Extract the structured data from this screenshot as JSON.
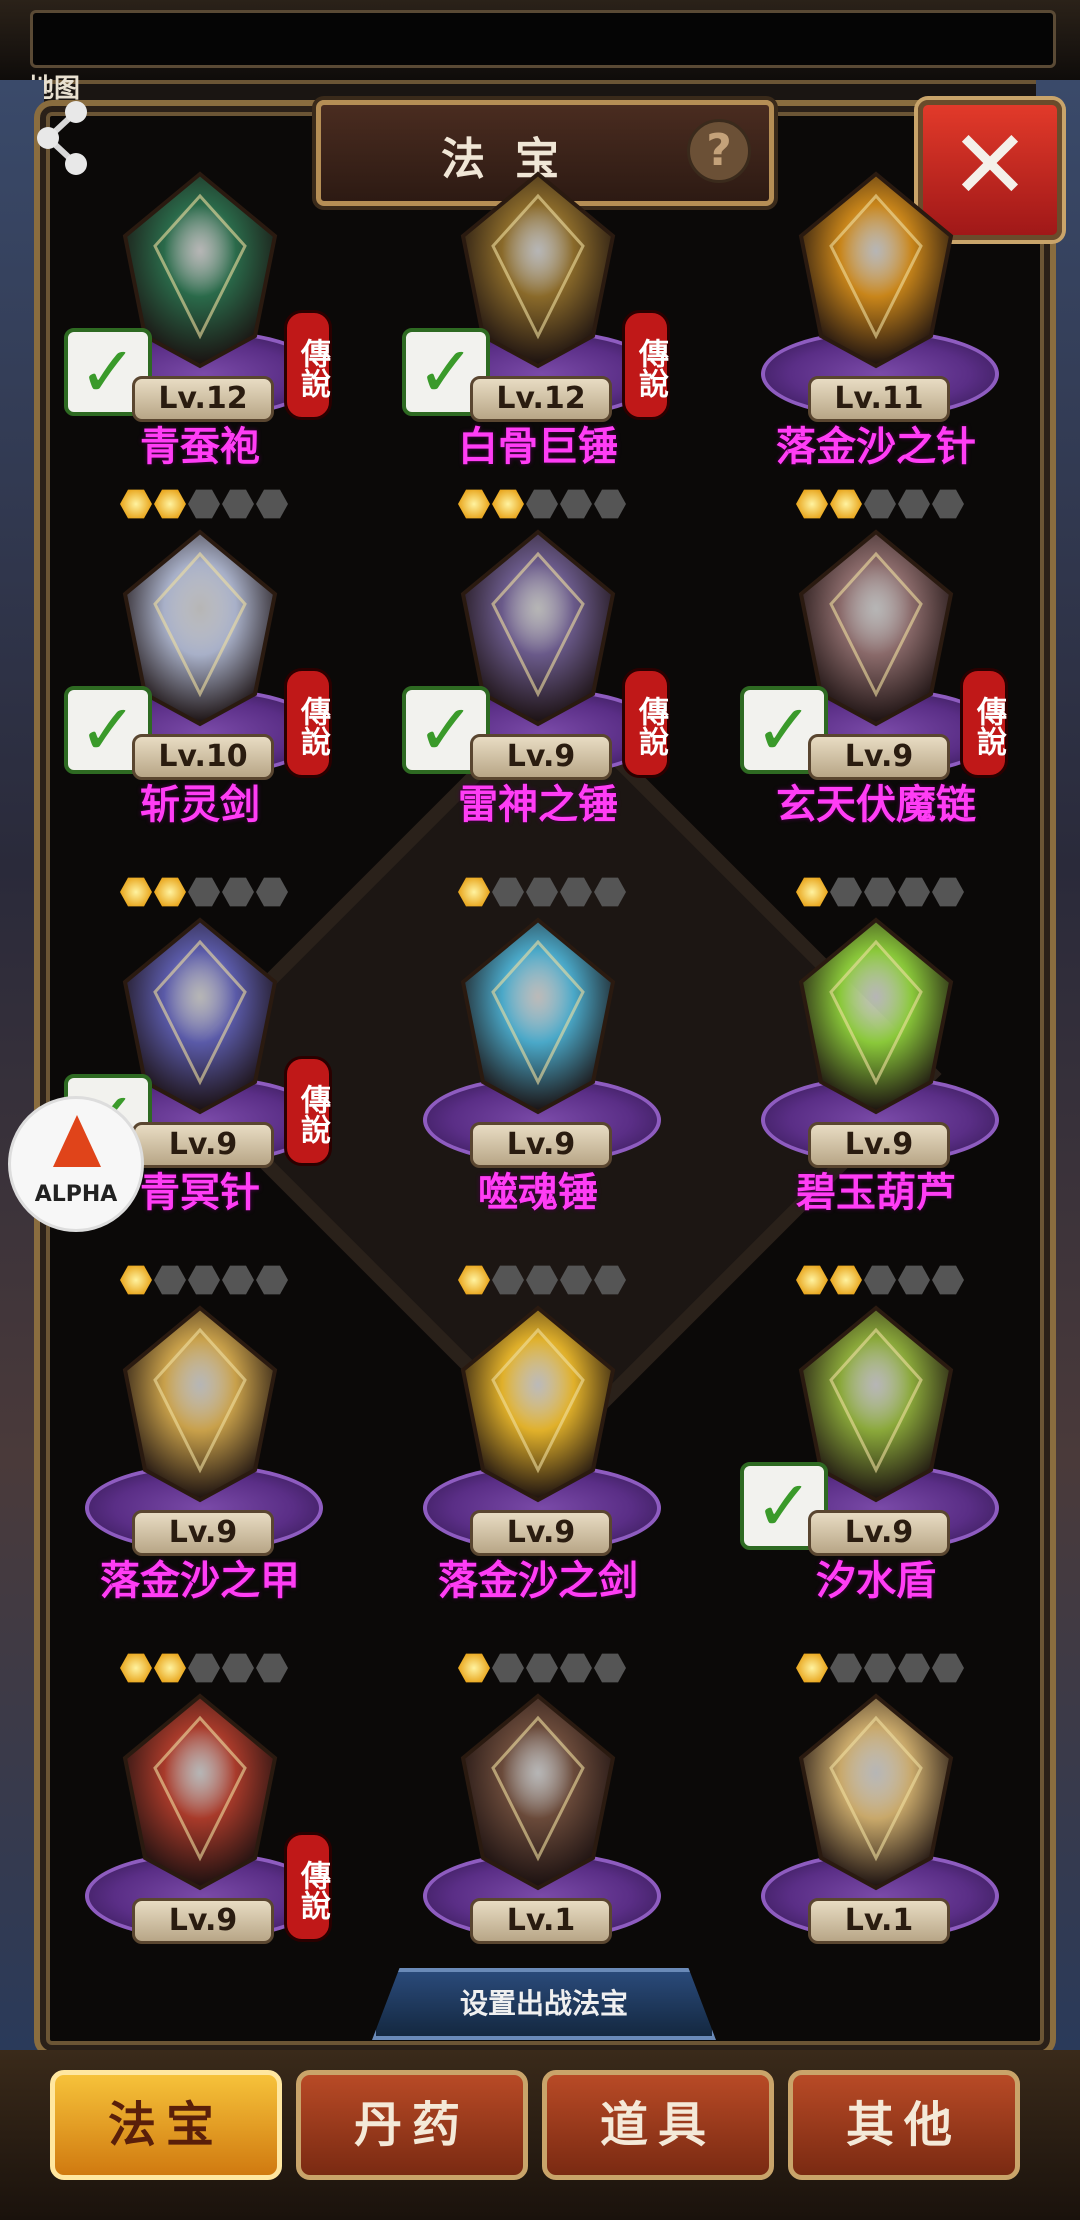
{
  "header": {
    "map_label": "地图",
    "title": "法宝",
    "help_glyph": "?",
    "close_glyph": "✕"
  },
  "grid": {
    "items": [
      {
        "name": "青蚕袍",
        "level": "Lv.12",
        "stars": 0,
        "legend": "傳說",
        "equipped": true,
        "color": "#2a6a4a"
      },
      {
        "name": "白骨巨锤",
        "level": "Lv.12",
        "stars": 0,
        "legend": "傳說",
        "equipped": true,
        "color": "#8a6a2a"
      },
      {
        "name": "落金沙之针",
        "level": "Lv.11",
        "stars": 0,
        "legend": "",
        "equipped": false,
        "color": "#c8851a"
      },
      {
        "name": "斩灵剑",
        "level": "Lv.10",
        "stars": 2,
        "legend": "傳說",
        "equipped": true,
        "color": "#a8b0c8"
      },
      {
        "name": "雷神之锤",
        "level": "Lv.9",
        "stars": 2,
        "legend": "傳說",
        "equipped": true,
        "color": "#6a5a8a"
      },
      {
        "name": "玄天伏魔链",
        "level": "Lv.9",
        "stars": 2,
        "legend": "傳說",
        "equipped": true,
        "color": "#8a6a6a"
      },
      {
        "name": "青冥针",
        "level": "Lv.9",
        "stars": 2,
        "legend": "傳說",
        "equipped": true,
        "color": "#5a5aa8"
      },
      {
        "name": "噬魂锤",
        "level": "Lv.9",
        "stars": 1,
        "legend": "",
        "equipped": false,
        "color": "#4aa8c8"
      },
      {
        "name": "碧玉葫芦",
        "level": "Lv.9",
        "stars": 1,
        "legend": "",
        "equipped": false,
        "color": "#8ac83a"
      },
      {
        "name": "落金沙之甲",
        "level": "Lv.9",
        "stars": 1,
        "legend": "",
        "equipped": false,
        "color": "#c8a04a"
      },
      {
        "name": "落金沙之剑",
        "level": "Lv.9",
        "stars": 1,
        "legend": "",
        "equipped": false,
        "color": "#e0b02a"
      },
      {
        "name": "汐水盾",
        "level": "Lv.9",
        "stars": 2,
        "legend": "",
        "equipped": true,
        "color": "#8aa83a"
      },
      {
        "name": "",
        "level": "Lv.9",
        "stars": 2,
        "legend": "傳說",
        "equipped": false,
        "color": "#a83a2a"
      },
      {
        "name": "",
        "level": "Lv.1",
        "stars": 1,
        "legend": "",
        "equipped": false,
        "color": "#6a4a3a"
      },
      {
        "name": "",
        "level": "Lv.1",
        "stars": 1,
        "legend": "",
        "equipped": false,
        "color": "#c8a86a"
      }
    ]
  },
  "footer": {
    "set_button": "设置出战法宝",
    "tabs": [
      {
        "label": "法宝",
        "active": true
      },
      {
        "label": "丹药",
        "active": false
      },
      {
        "label": "道具",
        "active": false
      },
      {
        "label": "其他",
        "active": false
      }
    ]
  },
  "overlay": {
    "alpha_label": "ALPHA"
  }
}
